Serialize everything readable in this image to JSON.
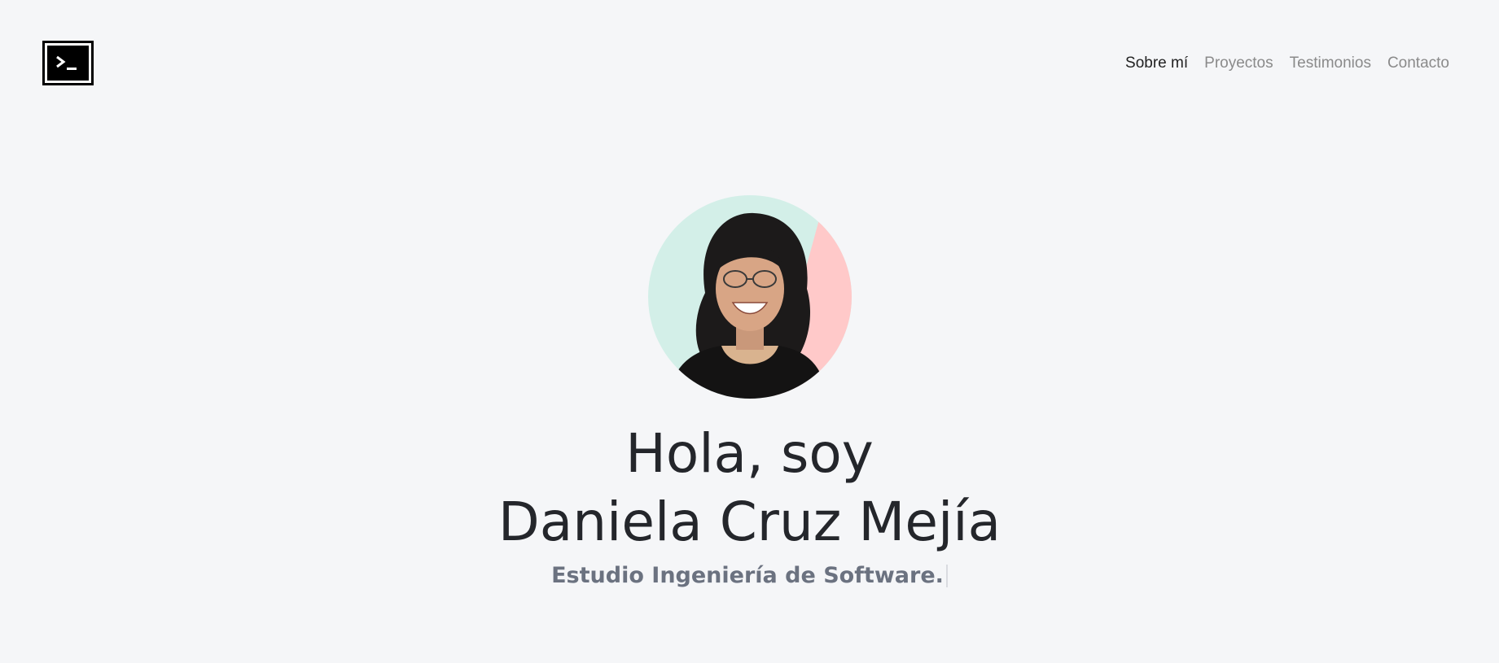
{
  "nav": {
    "items": [
      {
        "label": "Sobre mí",
        "active": true
      },
      {
        "label": "Proyectos",
        "active": false
      },
      {
        "label": "Testimonios",
        "active": false
      },
      {
        "label": "Contacto",
        "active": false
      }
    ]
  },
  "logo": {
    "icon": "terminal-icon"
  },
  "hero": {
    "greeting_line1": "Hola, soy",
    "greeting_line2": "Daniela Cruz Mejía",
    "tagline": "Estudio Ingeniería de Software."
  },
  "colors": {
    "background": "#f5f6f8",
    "heading": "#24262b",
    "tagline": "#6b7280",
    "nav_active": "#222222",
    "nav_inactive": "#8a8a8a",
    "avatar_mint": "#d3efe8",
    "avatar_pink": "#ffc9c9"
  }
}
